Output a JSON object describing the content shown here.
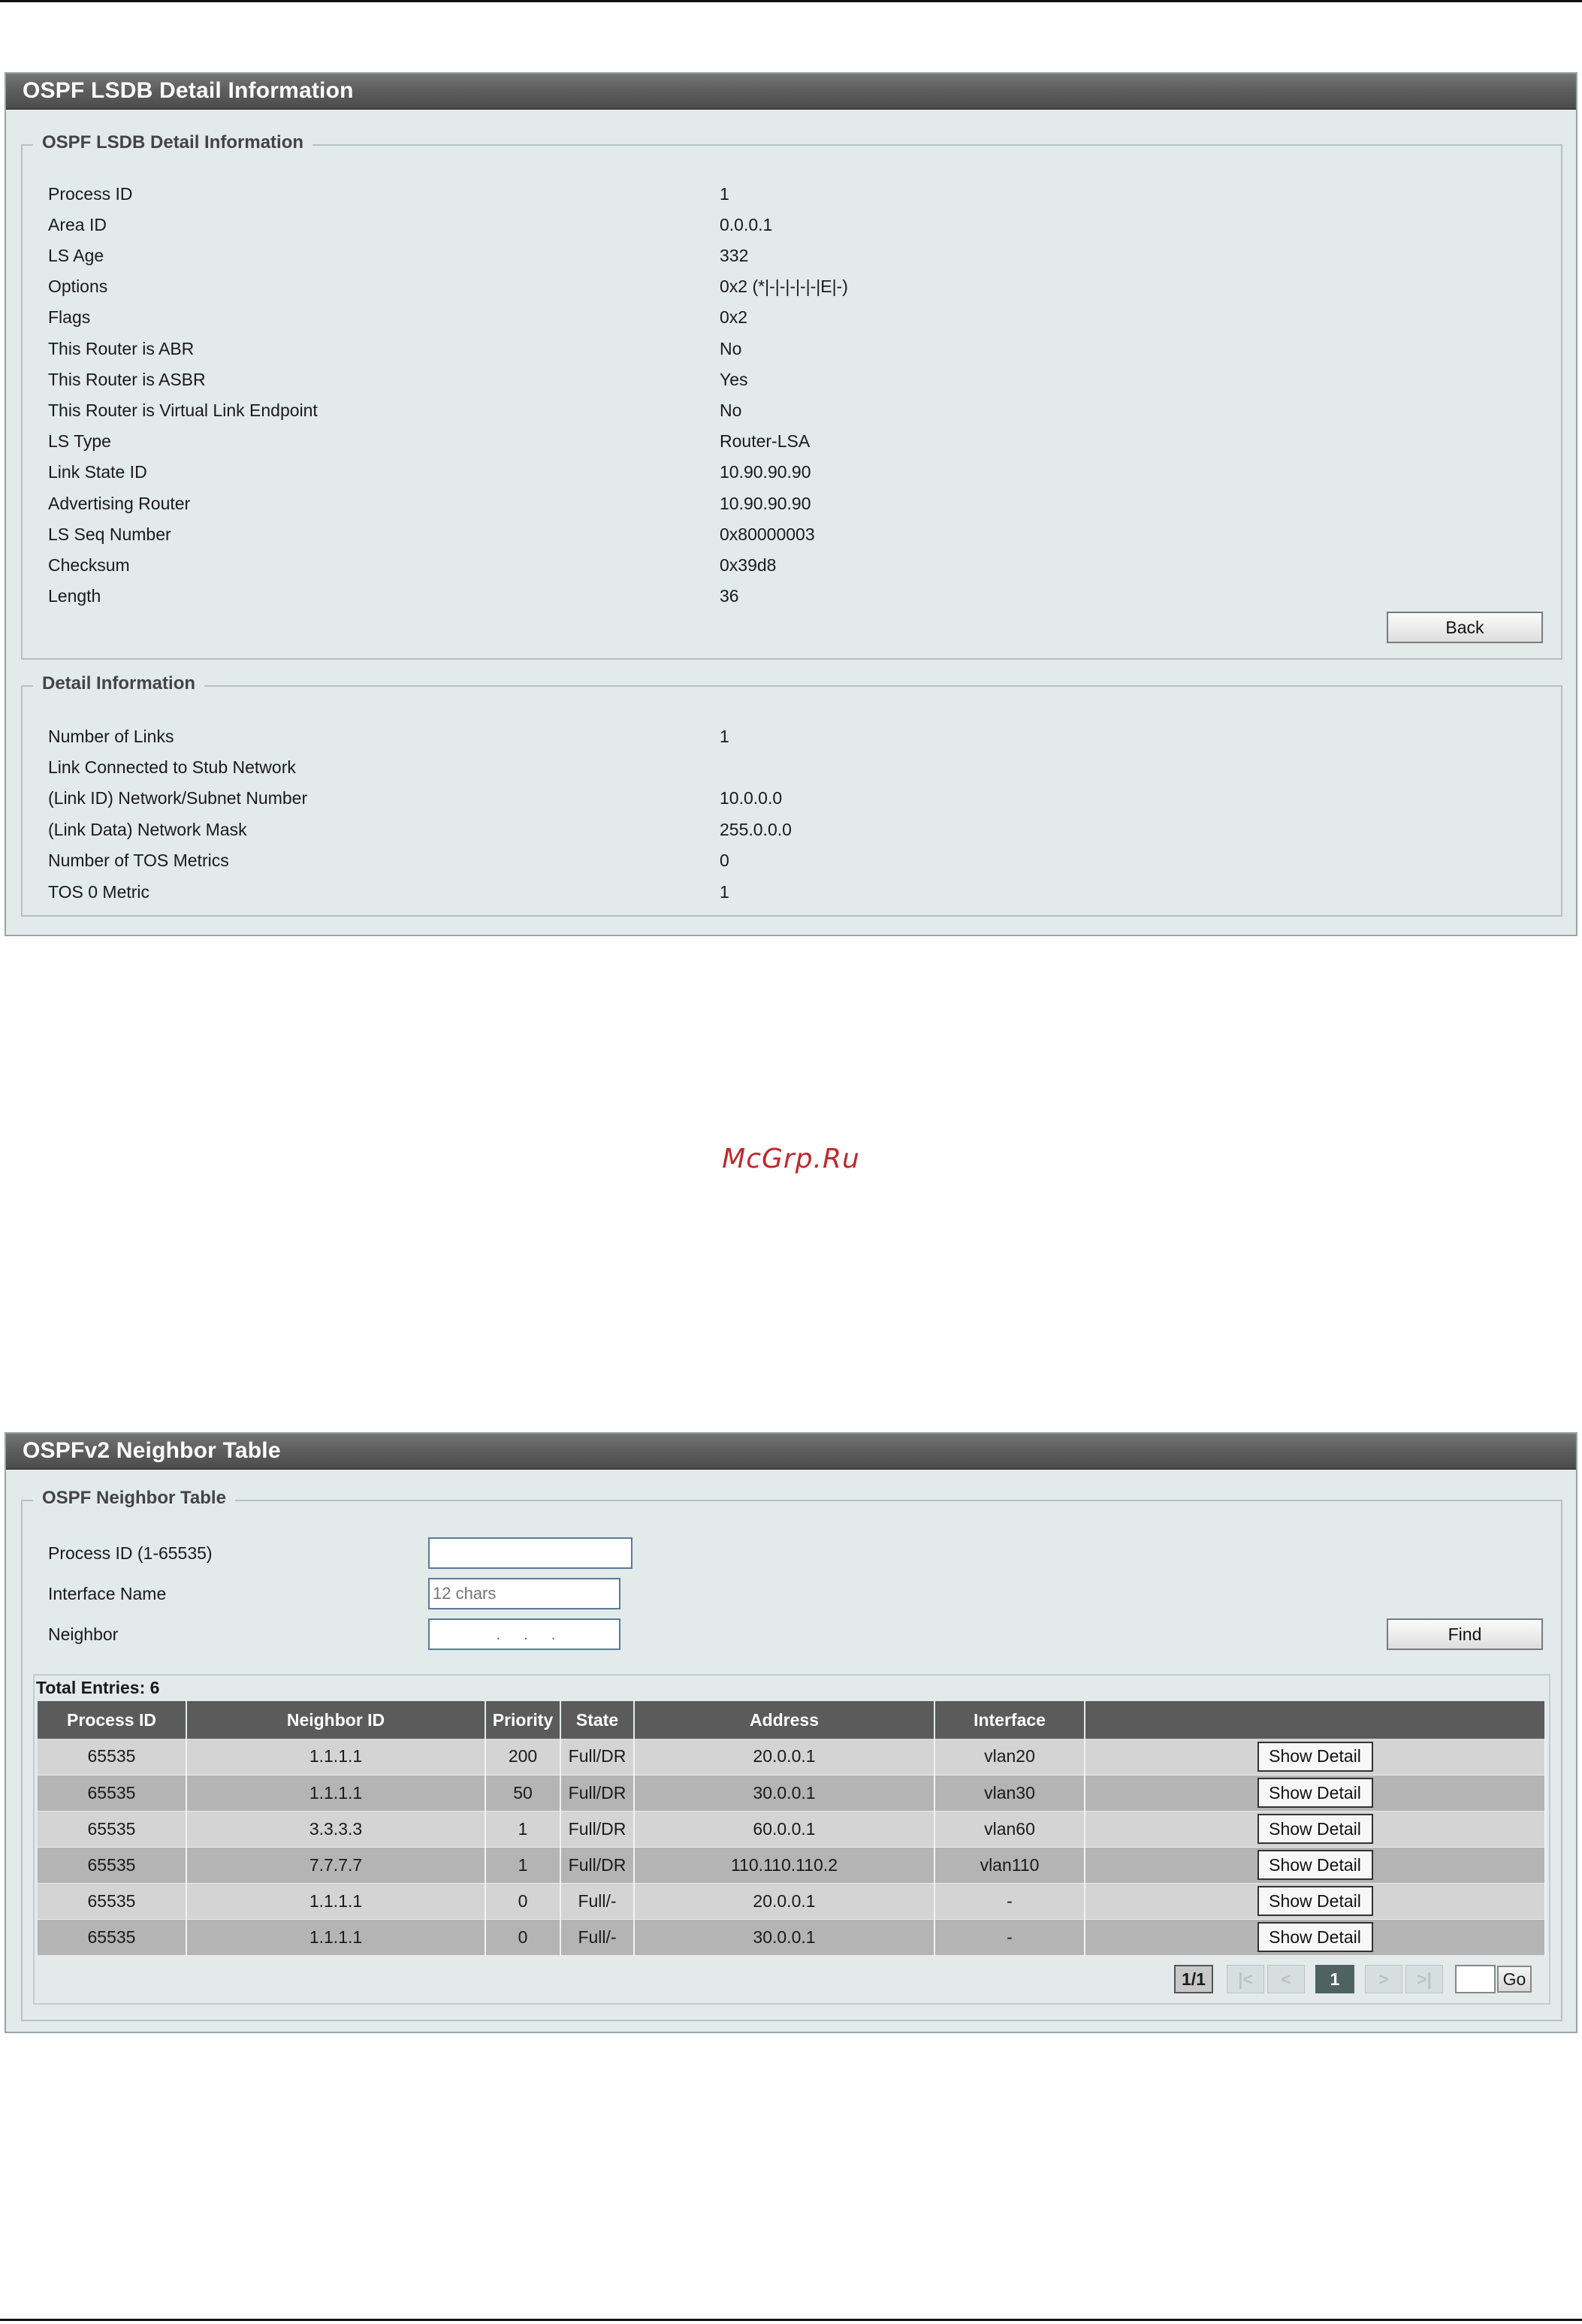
{
  "lsdb_panel": {
    "title": "OSPF LSDB Detail Information",
    "section_title": "OSPF LSDB Detail Information",
    "rows": [
      {
        "label": "Process ID",
        "value": "1"
      },
      {
        "label": "Area ID",
        "value": "0.0.0.1"
      },
      {
        "label": "LS Age",
        "value": "332"
      },
      {
        "label": "Options",
        "value": "0x2 (*|-|-|-|-|-|E|-)"
      },
      {
        "label": "Flags",
        "value": "0x2"
      },
      {
        "label": "This Router is ABR",
        "value": "No"
      },
      {
        "label": "This Router is ASBR",
        "value": "Yes"
      },
      {
        "label": "This Router is Virtual Link Endpoint",
        "value": "No"
      },
      {
        "label": "LS Type",
        "value": "Router-LSA"
      },
      {
        "label": "Link State ID",
        "value": "10.90.90.90"
      },
      {
        "label": "Advertising Router",
        "value": "10.90.90.90"
      },
      {
        "label": "LS Seq Number",
        "value": "0x80000003"
      },
      {
        "label": "Checksum",
        "value": "0x39d8"
      },
      {
        "label": "Length",
        "value": "36"
      }
    ],
    "back_label": "Back",
    "detail_section_title": "Detail Information",
    "detail_rows": [
      {
        "label": "Number of Links",
        "value": "1"
      },
      {
        "label": "Link Connected to Stub Network",
        "value": ""
      },
      {
        "label": "(Link ID) Network/Subnet Number",
        "value": "10.0.0.0"
      },
      {
        "label": "(Link Data) Network Mask",
        "value": "255.0.0.0"
      },
      {
        "label": "Number of TOS Metrics",
        "value": "0"
      },
      {
        "label": "TOS 0 Metric",
        "value": "1"
      }
    ]
  },
  "watermark": "McGrp.Ru",
  "neighbor_panel": {
    "title": "OSPFv2 Neighbor Table",
    "section_title": "OSPF Neighbor Table",
    "process_id_label": "Process ID (1-65535)",
    "process_id_value": "",
    "interface_label": "Interface Name",
    "interface_placeholder": "12 chars",
    "neighbor_label": "Neighbor",
    "neighbor_value": ".     .     .",
    "find_label": "Find",
    "total_entries": "Total Entries: 6",
    "columns": [
      "Process ID",
      "Neighbor ID",
      "Priority",
      "State",
      "Address",
      "Interface",
      ""
    ],
    "rows": [
      {
        "process_id": "65535",
        "neighbor_id": "1.1.1.1",
        "priority": "200",
        "state": "Full/DR",
        "address": "20.0.0.1",
        "interface": "vlan20",
        "action": "Show Detail"
      },
      {
        "process_id": "65535",
        "neighbor_id": "1.1.1.1",
        "priority": "50",
        "state": "Full/DR",
        "address": "30.0.0.1",
        "interface": "vlan30",
        "action": "Show Detail"
      },
      {
        "process_id": "65535",
        "neighbor_id": "3.3.3.3",
        "priority": "1",
        "state": "Full/DR",
        "address": "60.0.0.1",
        "interface": "vlan60",
        "action": "Show Detail"
      },
      {
        "process_id": "65535",
        "neighbor_id": "7.7.7.7",
        "priority": "1",
        "state": "Full/DR",
        "address": "110.110.110.2",
        "interface": "vlan110",
        "action": "Show Detail"
      },
      {
        "process_id": "65535",
        "neighbor_id": "1.1.1.1",
        "priority": "0",
        "state": "Full/-",
        "address": "20.0.0.1",
        "interface": "-",
        "action": "Show Detail"
      },
      {
        "process_id": "65535",
        "neighbor_id": "1.1.1.1",
        "priority": "0",
        "state": "Full/-",
        "address": "30.0.0.1",
        "interface": "-",
        "action": "Show Detail"
      }
    ],
    "pager": {
      "page_info": "1/1",
      "first": "|<",
      "prev": "<",
      "current": "1",
      "next": ">",
      "last": ">|",
      "go_label": "Go"
    }
  }
}
